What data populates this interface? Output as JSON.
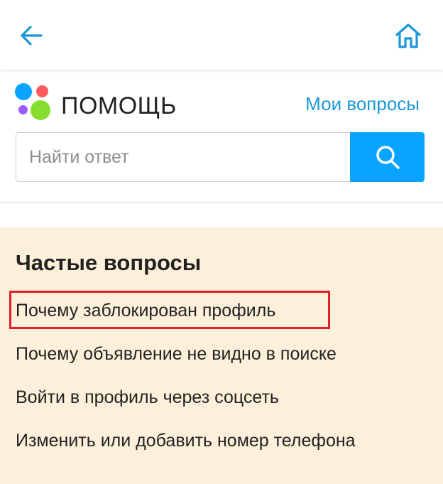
{
  "topbar": {
    "back_icon": "arrow-left-icon",
    "home_icon": "home-icon",
    "accent_color": "#1a98d8"
  },
  "header": {
    "title": "ПОМОЩЬ",
    "my_questions_label": "Мои вопросы",
    "logo_colors": [
      "#0aa3ff",
      "#ff5a5f",
      "#9a5bff",
      "#86dc2f"
    ]
  },
  "search": {
    "placeholder": "Найти ответ",
    "value": "",
    "button_icon": "search-icon",
    "button_color": "#0aa3ff"
  },
  "faq": {
    "title": "Частые вопросы",
    "background": "#fdf0da",
    "items": [
      {
        "label": "Почему заблокирован профиль",
        "highlighted": true
      },
      {
        "label": "Почему объявление не видно в поиске",
        "highlighted": false
      },
      {
        "label": "Войти в профиль через соцсеть",
        "highlighted": false
      },
      {
        "label": "Изменить или добавить номер телефона",
        "highlighted": false
      }
    ],
    "highlight_color": "#e11f2b"
  }
}
